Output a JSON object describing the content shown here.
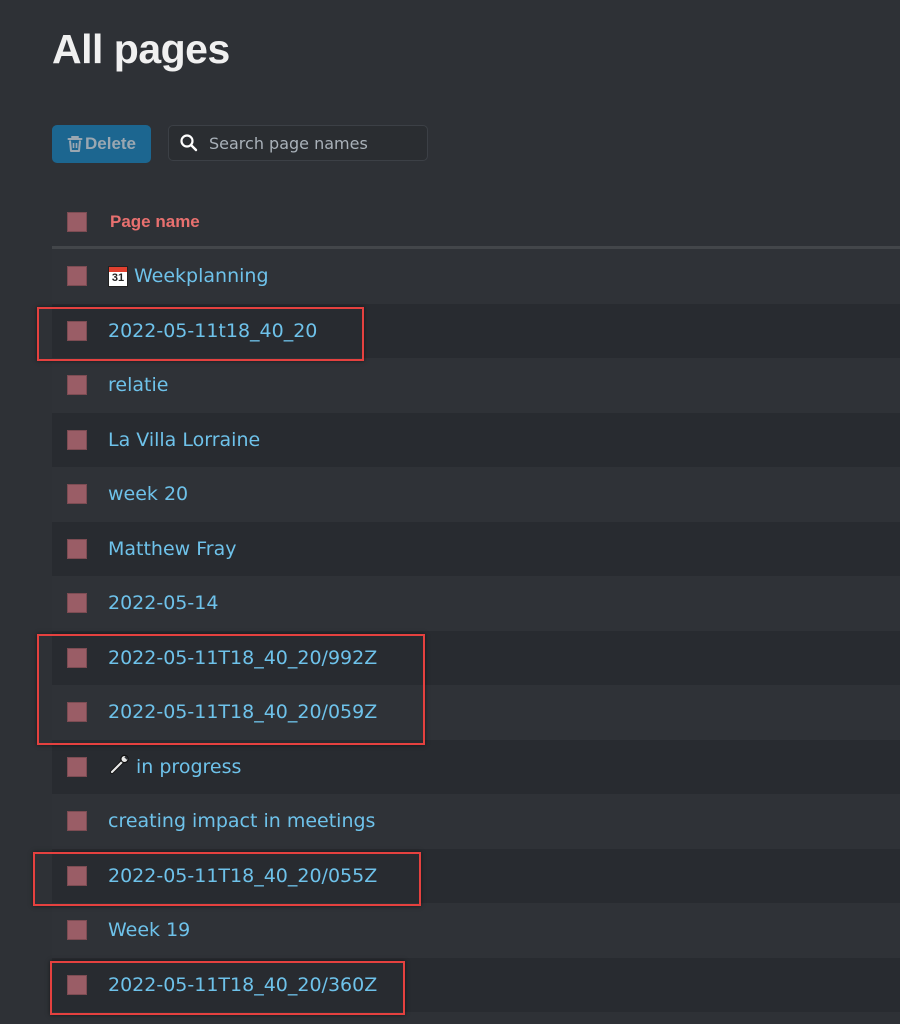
{
  "page": {
    "title": "All pages"
  },
  "toolbar": {
    "delete_label": "Delete",
    "delete_icon": "trash-icon",
    "search_icon": "search-icon",
    "search_placeholder": "Search page names",
    "search_value": ""
  },
  "table": {
    "header": {
      "column_label": "Page name"
    },
    "rows": [
      {
        "icon": "calendar-icon",
        "label": "Weekplanning",
        "highlighted": false
      },
      {
        "icon": "",
        "label": "2022-05-11t18_40_20",
        "highlighted": true
      },
      {
        "icon": "",
        "label": "relatie",
        "highlighted": false
      },
      {
        "icon": "",
        "label": "La Villa Lorraine",
        "highlighted": false
      },
      {
        "icon": "",
        "label": "week 20",
        "highlighted": false
      },
      {
        "icon": "",
        "label": "Matthew Fray",
        "highlighted": false
      },
      {
        "icon": "",
        "label": "2022-05-14",
        "highlighted": false
      },
      {
        "icon": "",
        "label": "2022-05-11T18_40_20/992Z",
        "highlighted": true
      },
      {
        "icon": "",
        "label": "2022-05-11T18_40_20/059Z",
        "highlighted": true
      },
      {
        "icon": "wrench-icon",
        "label": "in progress",
        "highlighted": false
      },
      {
        "icon": "",
        "label": "creating impact in meetings",
        "highlighted": false
      },
      {
        "icon": "",
        "label": "2022-05-11T18_40_20/055Z",
        "highlighted": true
      },
      {
        "icon": "",
        "label": "Week 19",
        "highlighted": false
      },
      {
        "icon": "",
        "label": "2022-05-11T18_40_20/360Z",
        "highlighted": true
      }
    ]
  },
  "colors": {
    "background": "#2e3136",
    "row_alt": "#282b30",
    "link": "#6ec2ea",
    "header_text": "#e8706f",
    "checkbox": "#9a5d66",
    "delete_button": "#1c6690",
    "annotation_box": "#e5413f"
  }
}
